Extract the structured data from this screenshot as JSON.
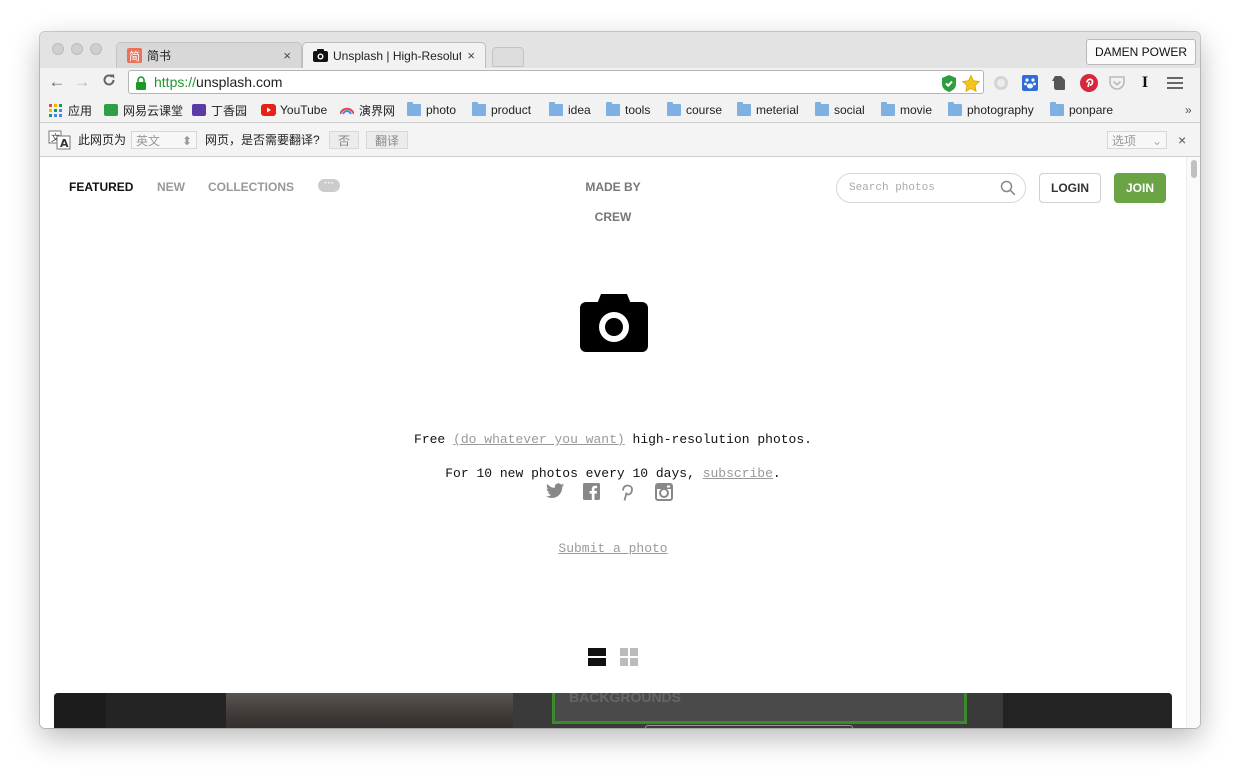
{
  "colors": {
    "accent_green": "#6aa444",
    "tab_bg": "#e3e3e3",
    "url_green": "#1a9b27"
  },
  "browser": {
    "tabs": [
      {
        "title": "简书",
        "favicon": "jianshu-icon",
        "close": "×"
      },
      {
        "title": "Unsplash | High-Resolution Photos",
        "favicon": "camera-icon",
        "close": "×"
      }
    ],
    "profile_name": "DAMEN POWER",
    "url_scheme": "https://",
    "url_host": "unsplash.com",
    "extensions": [
      "adblock-shield-icon",
      "star-icon",
      "globe-icon",
      "baidu-paw-icon",
      "evernote-icon",
      "pinterest-icon",
      "pocket-icon",
      "instapaper-icon",
      "menu-icon"
    ],
    "extension_glyphs": {
      "instapaper": "I"
    }
  },
  "bookmarks": [
    {
      "label": "应用",
      "icon": "apps-grid-icon"
    },
    {
      "label": "网易云课堂",
      "icon": "netease-study-icon"
    },
    {
      "label": "丁香园",
      "icon": "dxy-icon"
    },
    {
      "label": "YouTube",
      "icon": "youtube-icon"
    },
    {
      "label": "演界网",
      "icon": "yanjie-icon"
    },
    {
      "label": "photo",
      "icon": "folder-icon"
    },
    {
      "label": "product",
      "icon": "folder-icon"
    },
    {
      "label": "idea",
      "icon": "folder-icon"
    },
    {
      "label": "tools",
      "icon": "folder-icon"
    },
    {
      "label": "course",
      "icon": "folder-icon"
    },
    {
      "label": "meterial",
      "icon": "folder-icon"
    },
    {
      "label": "social",
      "icon": "folder-icon"
    },
    {
      "label": "movie",
      "icon": "folder-icon"
    },
    {
      "label": "photography",
      "icon": "folder-icon"
    },
    {
      "label": "ponpare",
      "icon": "folder-icon"
    }
  ],
  "bookmarks_overflow": "»",
  "translate_bar": {
    "prefix": "此网页为",
    "language": "英文",
    "question": "网页，是否需要翻译?",
    "no_label": "否",
    "translate_label": "翻译",
    "options_label": "选项",
    "close": "×"
  },
  "site": {
    "nav": {
      "featured": "FEATURED",
      "new": "NEW",
      "collections": "COLLECTIONS",
      "more": "···"
    },
    "made_by_line1": "MADE BY",
    "made_by_line2": "CREW",
    "search_placeholder": "Search photos",
    "login_label": "LOGIN",
    "join_label": "JOIN",
    "tagline_free": "Free",
    "tagline_link": "(do whatever you want)",
    "tagline_rest": "high-resolution photos.",
    "subscribe_prefix": "For 10 new photos every 10 days,",
    "subscribe_link": "subscribe",
    "subscribe_suffix": ".",
    "social_icons": [
      "twitter-icon",
      "facebook-icon",
      "pinterest-icon",
      "instagram-icon"
    ],
    "submit_label": "Submit a photo",
    "photo_strip_caption": "BACKGROUNDS"
  }
}
